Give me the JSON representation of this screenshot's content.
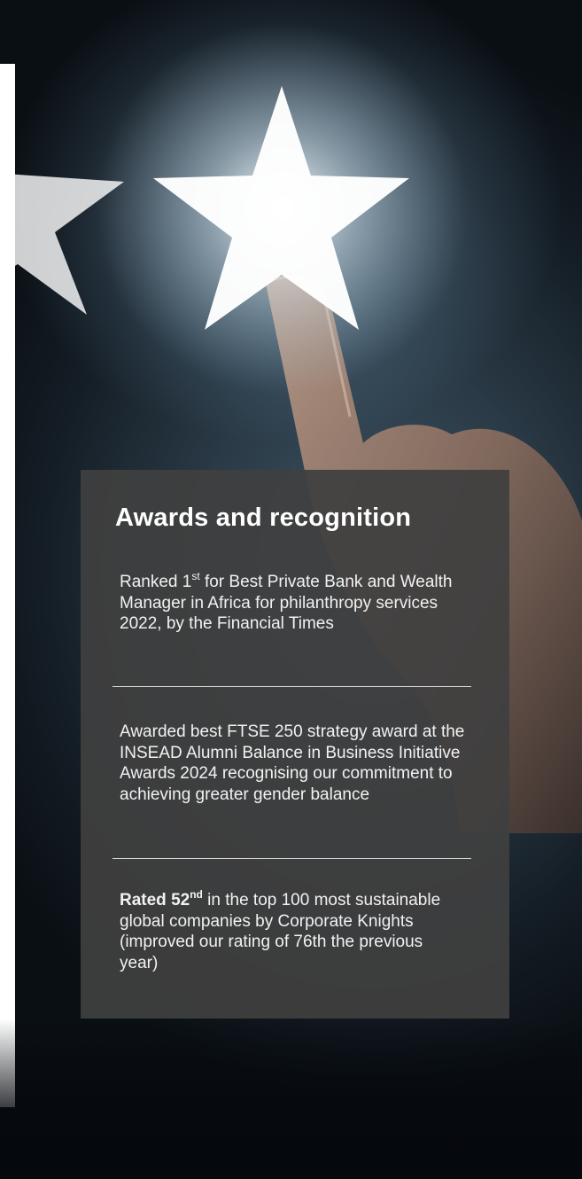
{
  "card": {
    "title": "Awards and recognition",
    "awards": [
      {
        "pre": "Ranked 1",
        "sup": "st",
        "post": " for Best Private Bank and Wealth Manager in Africa for philanthropy services 2022, by the Financial Times"
      },
      {
        "text": "Awarded best FTSE 250 strategy award at the INSEAD Alumni Balance in Business Initiative Awards 2024 recognising our commitment to achieving greater gender balance"
      },
      {
        "bold": "Rated 52",
        "sup": "nd",
        "post": " in the top 100 most sustainable global companies by Corporate Knights (improved our rating of 76th the previous year)"
      }
    ]
  },
  "colors": {
    "card_background": "#404040",
    "text": "#ffffff",
    "divider": "#d9d9d9"
  },
  "icons": {
    "main": "star-icon",
    "left": "star-icon"
  }
}
